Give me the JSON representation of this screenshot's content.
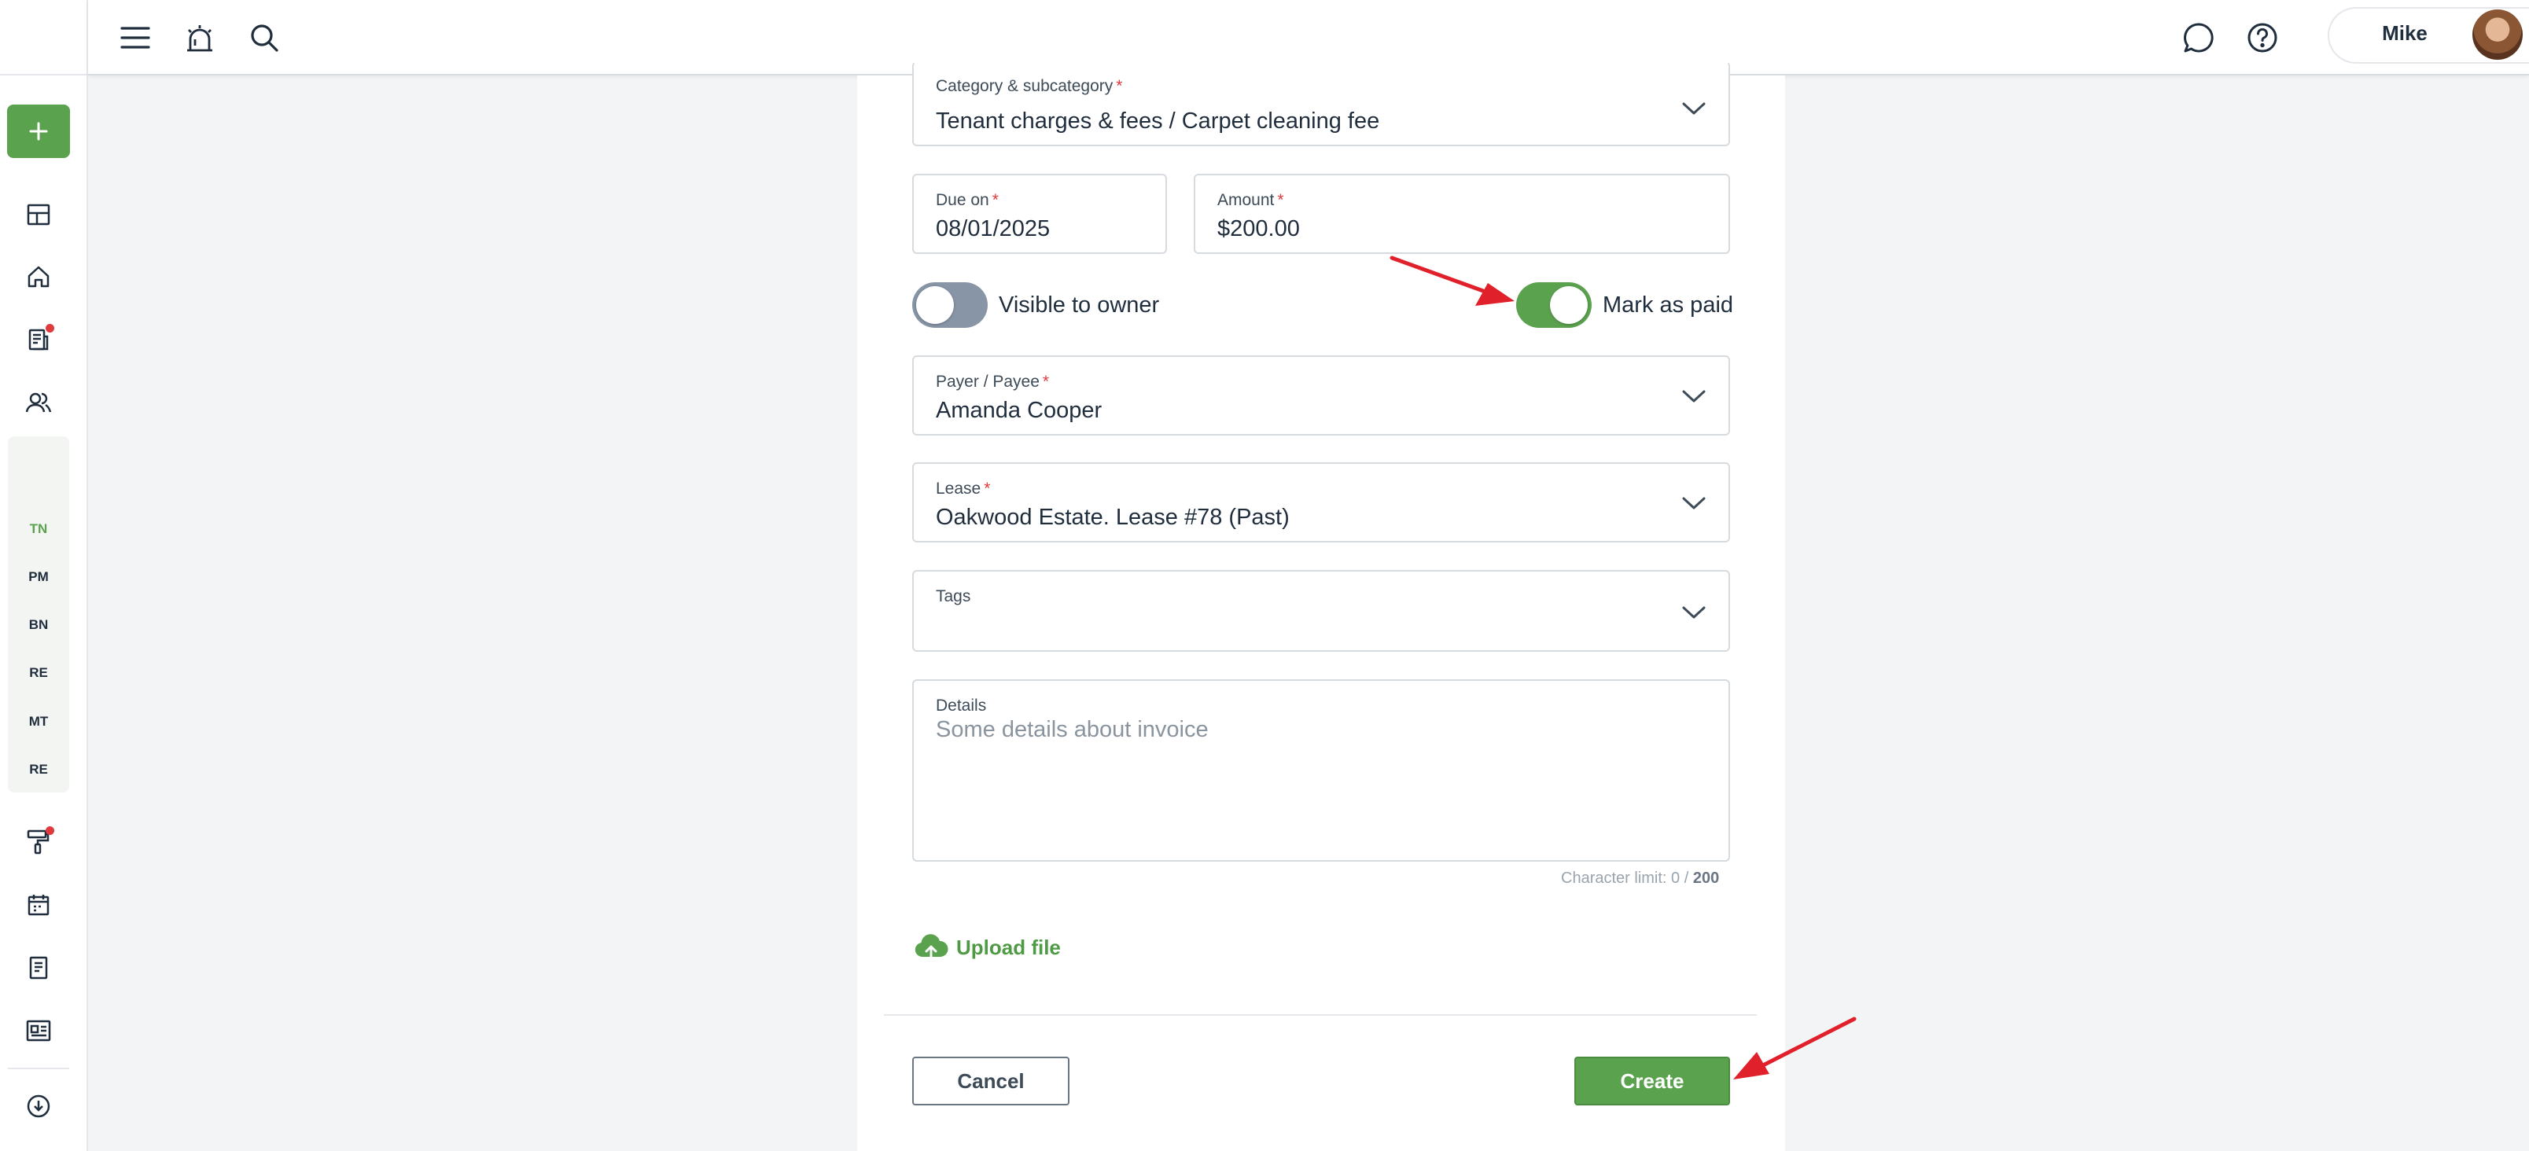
{
  "topbar": {
    "icons": [
      "menu-icon",
      "alarm-icon",
      "search-icon",
      "chat-icon",
      "help-icon"
    ],
    "user_name": "Mike"
  },
  "sidebar": {
    "add_icon": "plus-icon",
    "icons_top": [
      "dashboard-icon",
      "home-icon",
      "reports-icon",
      "people-icon",
      "dollar-icon"
    ],
    "accounting_items": [
      {
        "label": "TN",
        "active": true
      },
      {
        "label": "PM",
        "active": false
      },
      {
        "label": "BN",
        "active": false
      },
      {
        "label": "RE",
        "active": false
      },
      {
        "label": "MT",
        "active": false
      },
      {
        "label": "RE",
        "active": false
      }
    ],
    "icons_bottom": [
      "paint-roller-icon",
      "calendar-icon",
      "document-icon",
      "listing-icon",
      "download-cloud-icon"
    ]
  },
  "form": {
    "category": {
      "label": "Category & subcategory",
      "required_mark": "*",
      "value": "Tenant charges & fees / Carpet cleaning fee"
    },
    "due_on": {
      "label": "Due on",
      "required_mark": "*",
      "value": "08/01/2025"
    },
    "amount": {
      "label": "Amount",
      "required_mark": "*",
      "value": "$200.00"
    },
    "visible_to_owner": {
      "label": "Visible to owner",
      "on": false
    },
    "mark_as_paid": {
      "label": "Mark as paid",
      "on": true
    },
    "payer": {
      "label": "Payer / Payee",
      "required_mark": "*",
      "value": "Amanda Cooper"
    },
    "lease": {
      "label": "Lease",
      "required_mark": "*",
      "value": "Oakwood Estate. Lease #78 (Past)"
    },
    "tags": {
      "label": "Tags",
      "value": ""
    },
    "details": {
      "label": "Details",
      "placeholder": "Some details about invoice",
      "value": ""
    },
    "char_limit": {
      "prefix": "Character limit: 0 / ",
      "max": "200"
    },
    "upload_label": "Upload file",
    "cancel_label": "Cancel",
    "create_label": "Create"
  },
  "colors": {
    "brand_green": "#5ba24f",
    "toggle_off": "#8795a7",
    "required_red": "#e0393e",
    "annotation_red": "#e0202a"
  }
}
